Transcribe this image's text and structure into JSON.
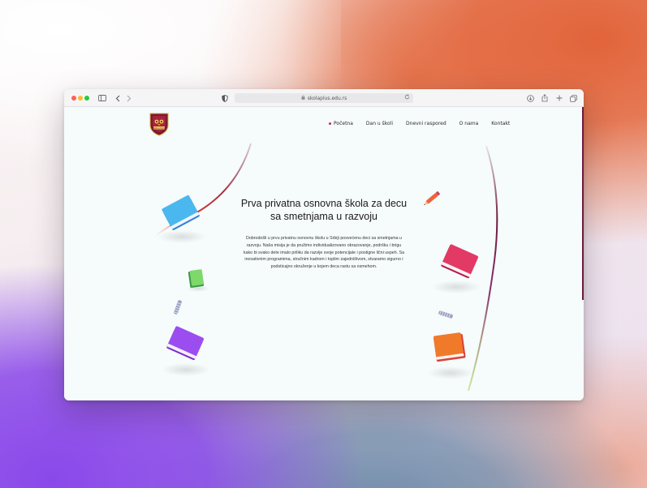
{
  "browser": {
    "url": "skolaplus.edu.rs",
    "icons": {
      "sidebar": "sidebar-icon",
      "back": "chevron-left-icon",
      "forward": "chevron-right-icon",
      "privacy": "shield-half-icon",
      "lock": "lock-icon",
      "reload": "reload-icon",
      "download": "download-icon",
      "share": "share-icon",
      "new_tab": "plus-icon",
      "tabs": "tabs-overview-icon"
    }
  },
  "site": {
    "logo_text": "SKOLA PLUS",
    "nav": [
      {
        "label": "Početna",
        "active": true
      },
      {
        "label": "Dan u školi",
        "active": false
      },
      {
        "label": "Dnevni raspored",
        "active": false
      },
      {
        "label": "O nama",
        "active": false
      },
      {
        "label": "Kontakt",
        "active": false
      }
    ],
    "hero": {
      "title_line1": "Prva privatna osnovna škola za decu",
      "title_line2": "sa smetnjama u razvoju",
      "body": "Dobrodošli u prvu privatnu osnovnu školu u Srbiji posvećenu deci sa smetnjama u razvoju. Naša misija je da pružimo individualizovano obrazovanje, podršku i brigu kako bi svako dete imalo priliku da razvije svoje potencijale i postigne lični uspeh. Sa inovativnim programima, stručnim kadrom i toplim zajedništvom, stvaramo sigurno i podsticajno okruženje u kojem deca rastu sa osmehom."
    }
  },
  "colors": {
    "accent": "#6d1b3c",
    "nav_bullet": "#c03048"
  }
}
